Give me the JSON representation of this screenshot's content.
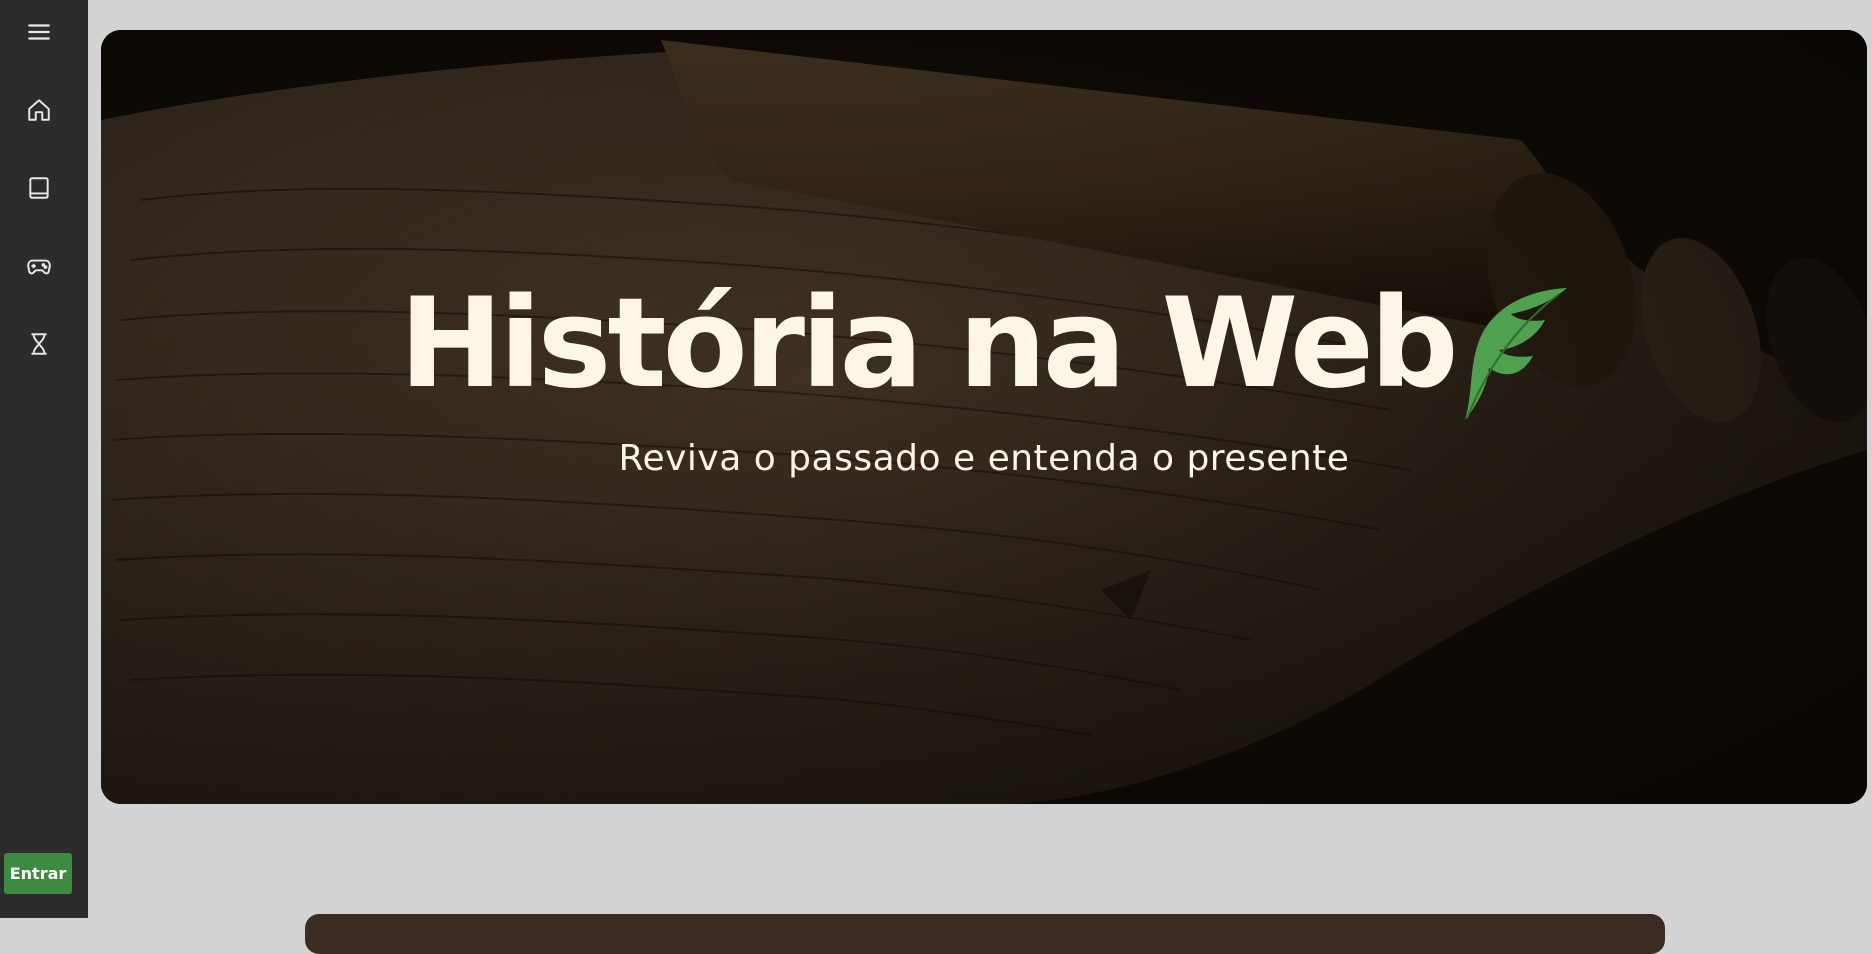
{
  "sidebar": {
    "items": [
      {
        "icon": "menu-icon"
      },
      {
        "icon": "home-icon"
      },
      {
        "icon": "book-icon"
      },
      {
        "icon": "gamepad-icon"
      },
      {
        "icon": "hourglass-icon"
      }
    ],
    "login_label": "Entrar",
    "login_color": "#3d8b40"
  },
  "hero": {
    "title": "História na Web",
    "subtitle": "Reviva o passado e entenda o presente",
    "title_color": "#fcf6e8",
    "accent_color": "#4fa04f",
    "logo_icon": "feather-icon"
  }
}
